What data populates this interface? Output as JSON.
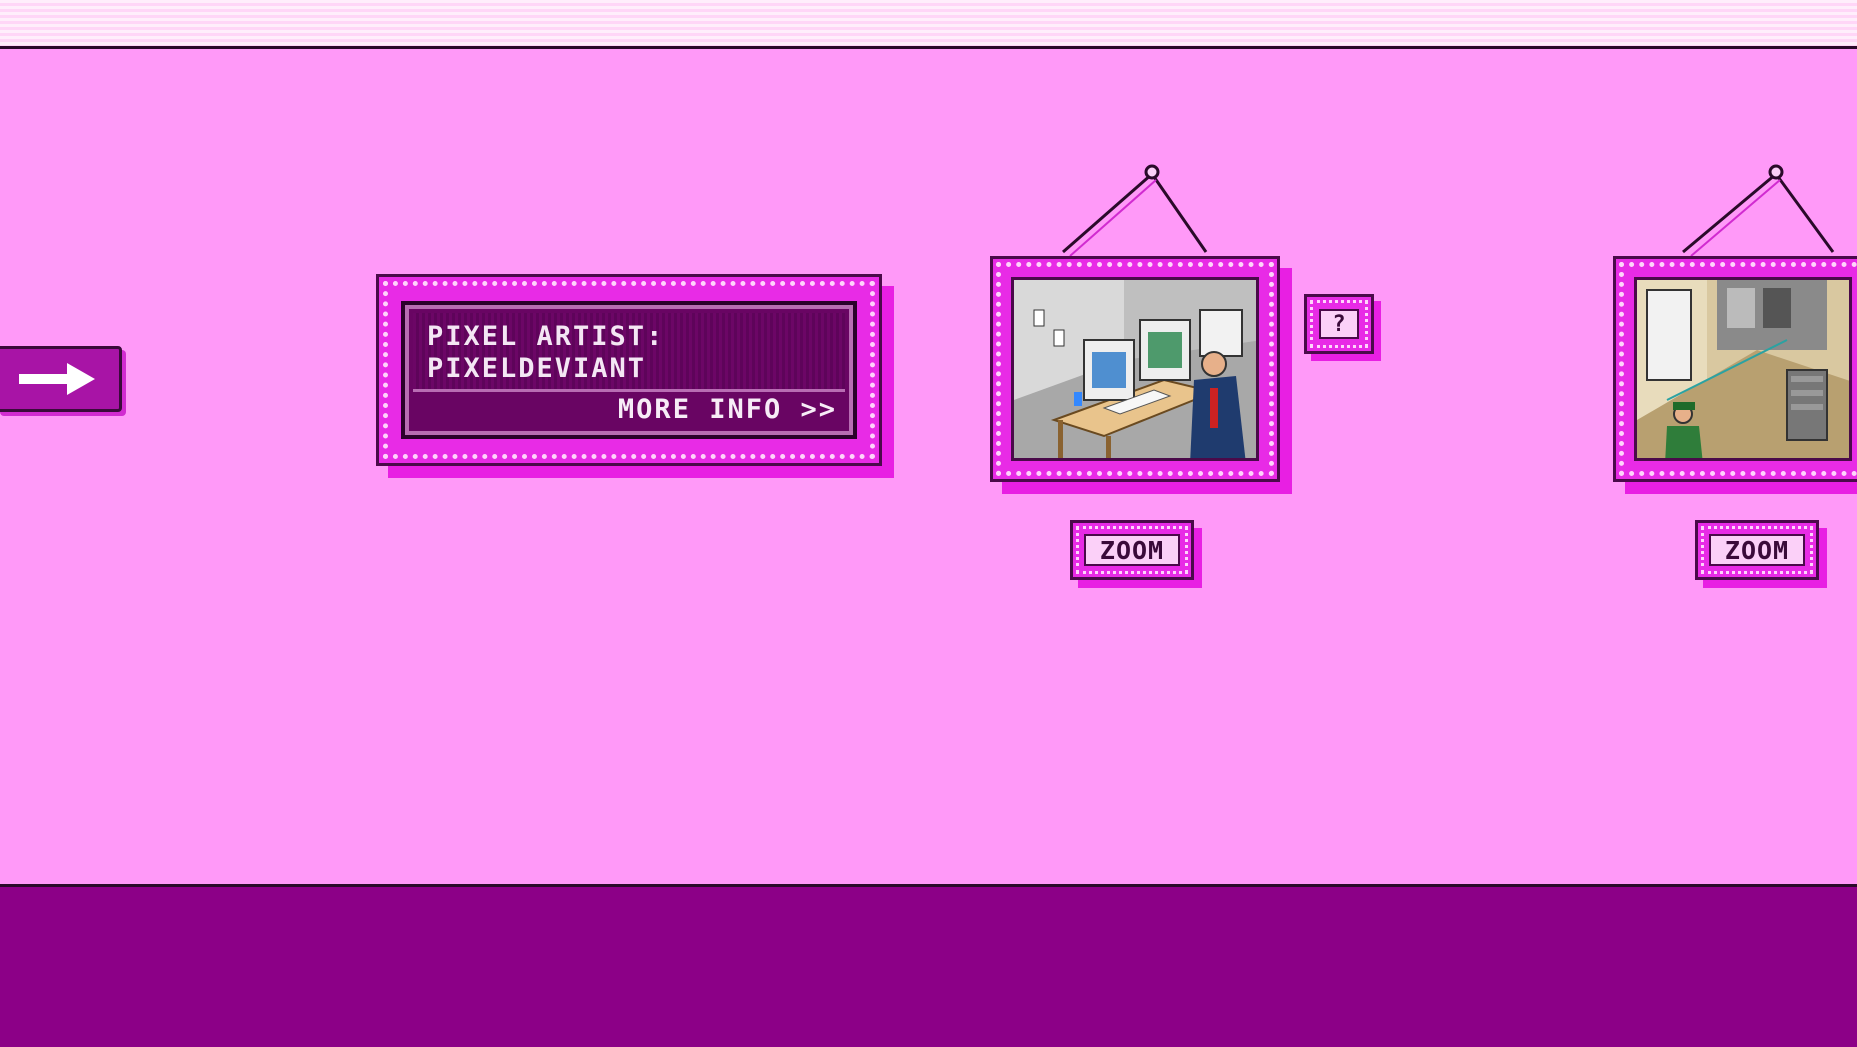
{
  "gallery": {
    "artist_label": "PIXEL ARTIST:",
    "artist_name": "PIXELDEVIANT",
    "more_info_label": "MORE INFO >>",
    "help_label": "?",
    "artworks": [
      {
        "zoom_label": "ZOOM",
        "scene": "office-computer-desk"
      },
      {
        "zoom_label": "ZOOM",
        "scene": "room-with-soldier"
      }
    ],
    "nav_icon": "right-arrow-icon"
  },
  "colors": {
    "wall": "#ff99f8",
    "floor": "#8c0087",
    "frame": "#e82be6",
    "plaque_inner": "#690563"
  }
}
